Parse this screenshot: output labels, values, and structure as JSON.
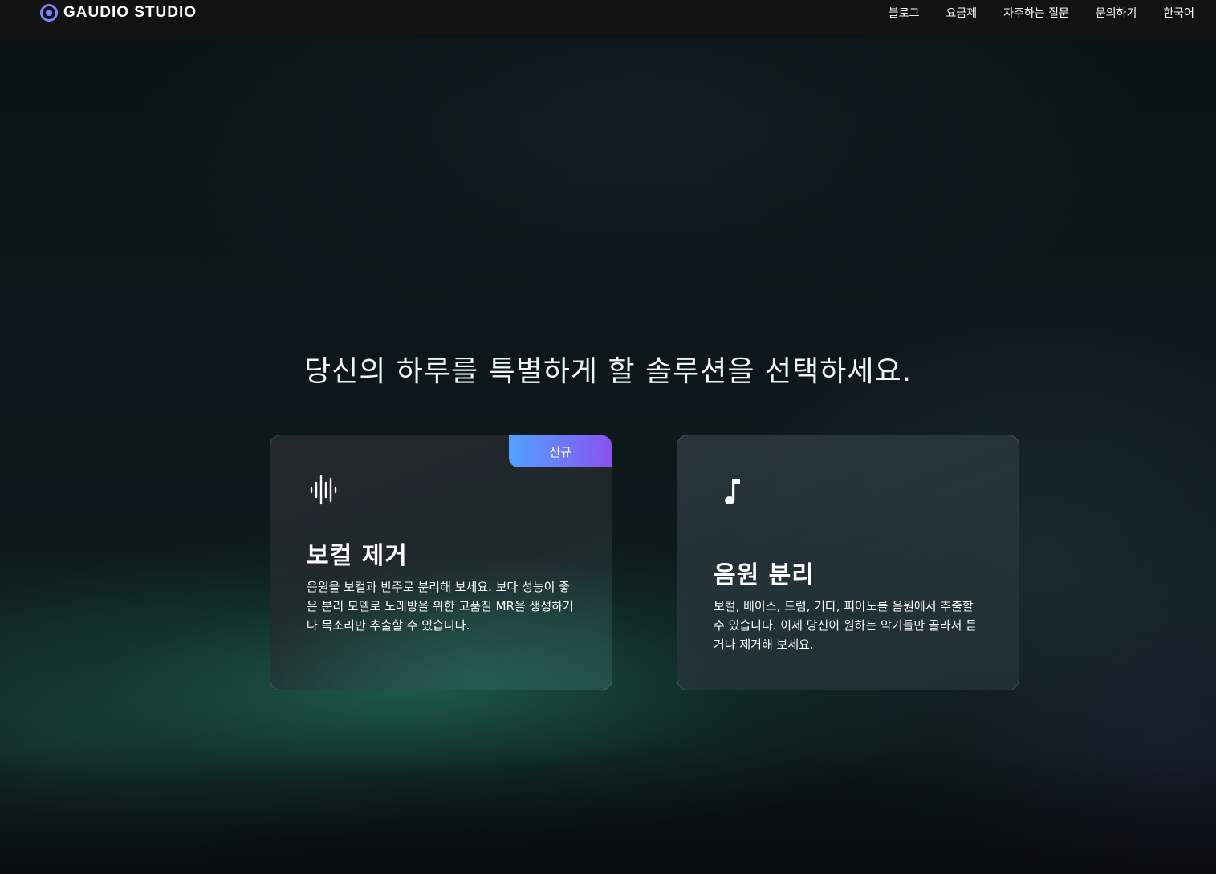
{
  "header": {
    "brand": "GAUDIO STUDIO",
    "nav": [
      {
        "label": "블로그"
      },
      {
        "label": "요금제"
      },
      {
        "label": "자주하는 질문"
      },
      {
        "label": "문의하기"
      },
      {
        "label": "한국어"
      }
    ]
  },
  "main": {
    "headline": "당신의 하루를 특별하게 할 솔루션을 선택하세요.",
    "cards": [
      {
        "icon": "waveform-icon",
        "badge": "신규",
        "title": "보컬 제거",
        "description": "음원을 보컬과 반주로 분리해 보세요. 보다 성능이 좋은 분리 모델로 노래방을 위한 고품질 MR을 생성하거나 목소리만 추출할 수 있습니다."
      },
      {
        "icon": "music-note-icon",
        "title": "음원 분리",
        "description": "보컬, 베이스, 드럼, 기타, 피아노를 음원에서 추출할 수 있습니다. 이제 당신이 원하는 악기들만 골라서 듣거나 제거해 보세요."
      }
    ]
  },
  "colors": {
    "brand_accent": "#7d83ff",
    "badge_gradient_start": "#4fa2ff",
    "badge_gradient_end": "#8a52f2",
    "header_bg": "#121212"
  }
}
